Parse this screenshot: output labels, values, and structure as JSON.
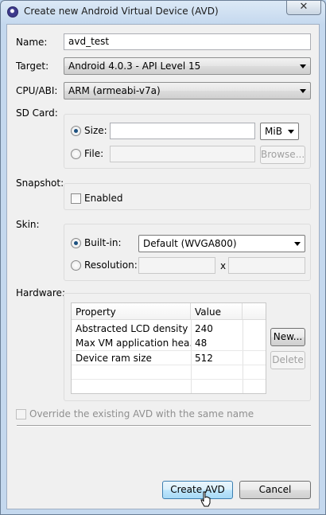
{
  "window": {
    "title": "Create new Android Virtual Device (AVD)",
    "close_glyph": "✕"
  },
  "form": {
    "name_label": "Name:",
    "name_value": "avd_test",
    "target_label": "Target:",
    "target_value": "Android 4.0.3 - API Level 15",
    "cpu_label": "CPU/ABI:",
    "cpu_value": "ARM (armeabi-v7a)"
  },
  "sdcard": {
    "label": "SD Card:",
    "size_label": "Size:",
    "size_value": "",
    "unit_value": "MiB",
    "file_label": "File:",
    "file_value": "",
    "browse_label": "Browse...",
    "selected": "size"
  },
  "snapshot": {
    "label": "Snapshot:",
    "enabled_label": "Enabled",
    "enabled": false
  },
  "skin": {
    "label": "Skin:",
    "builtin_label": "Built-in:",
    "builtin_value": "Default (WVGA800)",
    "resolution_label": "Resolution:",
    "res_width": "",
    "res_sep": "x",
    "res_height": "",
    "selected": "builtin"
  },
  "hardware": {
    "label": "Hardware:",
    "columns": [
      "Property",
      "Value"
    ],
    "rows": [
      {
        "property": "Abstracted LCD density",
        "value": "240"
      },
      {
        "property": "Max VM application hea...",
        "value": "48"
      },
      {
        "property": "Device ram size",
        "value": "512"
      }
    ],
    "new_label": "New...",
    "delete_label": "Delete"
  },
  "override": {
    "label": "Override the existing AVD with the same name",
    "checked": false
  },
  "actions": {
    "create_label": "Create AVD",
    "cancel_label": "Cancel"
  }
}
